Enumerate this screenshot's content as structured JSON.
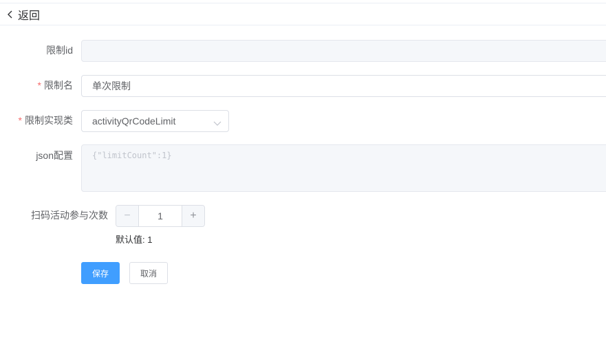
{
  "header": {
    "back_label": "返回"
  },
  "form": {
    "limit_id": {
      "label": "限制id",
      "value": ""
    },
    "limit_name": {
      "label": "限制名",
      "required_mark": "*",
      "value": "单次限制"
    },
    "limit_impl": {
      "label": "限制实现类",
      "required_mark": "*",
      "value": "activityQrCodeLimit"
    },
    "json_config": {
      "label": "json配置",
      "value": "{\"limitCount\":1}"
    },
    "scan_count": {
      "label": "扫码活动参与次数",
      "value": "1",
      "minus_symbol": "−",
      "plus_symbol": "+",
      "hint": "默认值: 1"
    }
  },
  "actions": {
    "save_label": "保存",
    "cancel_label": "取消"
  },
  "colors": {
    "primary": "#409eff",
    "required": "#f56c6c"
  },
  "icons": {
    "back": "chevron-left-icon",
    "select": "chevron-down-icon"
  }
}
